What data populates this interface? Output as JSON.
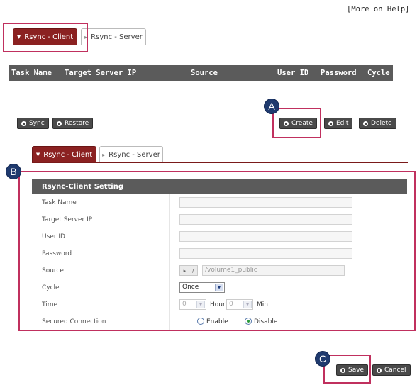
{
  "help": "[More on Help]",
  "tabs_top": {
    "client": "Rsync - Client",
    "server": "Rsync - Server"
  },
  "table": {
    "cols": [
      "Task Name",
      "Target Server IP",
      "Source",
      "User ID",
      "Password",
      "Cycle"
    ]
  },
  "buttons": {
    "sync": "Sync",
    "restore": "Restore",
    "create": "Create",
    "edit": "Edit",
    "delete": "Delete",
    "save": "Save",
    "cancel": "Cancel"
  },
  "badges": {
    "a": "A",
    "b": "B",
    "c": "C"
  },
  "tabs_inner": {
    "client": "Rsync - Client",
    "server": "Rsync - Server"
  },
  "settings": {
    "title": "Rsync-Client Setting",
    "labels": {
      "task_name": "Task Name",
      "target_ip": "Target Server IP",
      "user_id": "User ID",
      "password": "Password",
      "source": "Source",
      "cycle": "Cycle",
      "time": "Time",
      "secured": "Secured Connection"
    },
    "source_btn": "▸..../",
    "source_path": "/volume1_public",
    "cycle_value": "Once",
    "hour_value": "0",
    "min_value": "0",
    "hour_label": "Hour",
    "min_label": "Min",
    "enable": "Enable",
    "disable": "Disable"
  }
}
